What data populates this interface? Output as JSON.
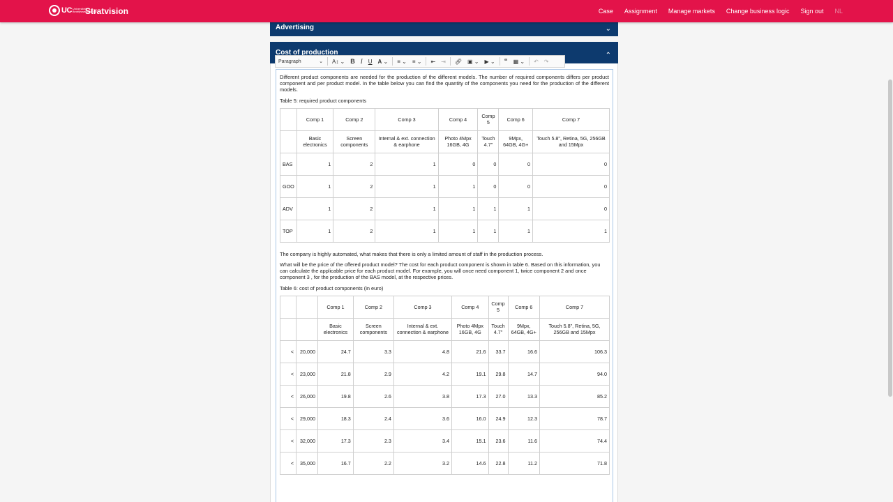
{
  "app": {
    "logo_text": "UC",
    "logo_sub": "Universiteit Bedrijfswetenschap",
    "title": "Stratvision"
  },
  "nav": {
    "items": [
      "Case",
      "Assignment",
      "Manage markets",
      "Change business logic",
      "Sign out"
    ],
    "lang": "NL"
  },
  "accordion": {
    "advertising": "Advertising",
    "cost": "Cost of production"
  },
  "toolbar": {
    "paragraph": "Paragraph"
  },
  "content": {
    "intro": "Different product components are needed for the production of the different models. The number of required components differs per product component and per product model. In the table below you can find the quantity of the components you need for the production of the different models.",
    "table5_caption": "Table 5: required product components",
    "automated": "The company is highly automated, what makes that there is only a limited amount of staff in the production process.",
    "price_text": "What will be the price of the offered product model? The cost for each product component is shown in table 6. Based on this information, you can calculate the applicable price for each product model. For example, you will once need component 1, twice component 2  and once component 3 , for the production of the BAS model, at the respective prices.",
    "table6_caption": "Table 6: cost of product components (in euro)"
  },
  "table5": {
    "headers": [
      "Comp 1",
      "Comp 2",
      "Comp 3",
      "Comp 4",
      "Comp 5",
      "Comp 6",
      "Comp 7"
    ],
    "descriptions": [
      "Basic electronics",
      "Screen components",
      "Internal & ext. connection & earphone",
      "Photo 4Mpx 16GB, 4G",
      "Touch 4.7\"",
      "9Mpx, 64GB, 4G+",
      "Touch 5.8\", Retina, 5G, 256GB and 15Mpx"
    ],
    "rows": [
      {
        "label": "BAS",
        "values": [
          "1",
          "2",
          "1",
          "0",
          "0",
          "0",
          "0"
        ]
      },
      {
        "label": "GOO",
        "values": [
          "1",
          "2",
          "1",
          "1",
          "0",
          "0",
          "0"
        ]
      },
      {
        "label": "ADV",
        "values": [
          "1",
          "2",
          "1",
          "1",
          "1",
          "1",
          "0"
        ]
      },
      {
        "label": "TOP",
        "values": [
          "1",
          "2",
          "1",
          "1",
          "1",
          "1",
          "1"
        ]
      }
    ]
  },
  "table6": {
    "headers": [
      "Comp 1",
      "Comp 2",
      "Comp 3",
      "Comp 4",
      "Comp 5",
      "Comp 6",
      "Comp 7"
    ],
    "descriptions": [
      "Basic electronics",
      "Screen components",
      "Internal & ext. connection & earphone",
      "Photo 4Mpx 16GB, 4G",
      "Touch 4.7\"",
      "9Mpx, 64GB, 4G+",
      "Touch 5.8\", Retina, 5G, 256GB and 15Mpx"
    ],
    "rows": [
      {
        "op": "<",
        "qty": "20,000",
        "values": [
          "24.7",
          "3.3",
          "4.8",
          "21.6",
          "33.7",
          "16.6",
          "106.3"
        ]
      },
      {
        "op": "<",
        "qty": "23,000",
        "values": [
          "21.8",
          "2.9",
          "4.2",
          "19.1",
          "29.8",
          "14.7",
          "94.0"
        ]
      },
      {
        "op": "<",
        "qty": "26,000",
        "values": [
          "19.8",
          "2.6",
          "3.8",
          "17.3",
          "27.0",
          "13.3",
          "85.2"
        ]
      },
      {
        "op": "<",
        "qty": "29,000",
        "values": [
          "18.3",
          "2.4",
          "3.6",
          "16.0",
          "24.9",
          "12.3",
          "78.7"
        ]
      },
      {
        "op": "<",
        "qty": "32,000",
        "values": [
          "17.3",
          "2.3",
          "3.4",
          "15.1",
          "23.6",
          "11.6",
          "74.4"
        ]
      },
      {
        "op": "<",
        "qty": "35,000",
        "values": [
          "16.7",
          "2.2",
          "3.2",
          "14.6",
          "22.8",
          "11.2",
          "71.8"
        ]
      }
    ]
  }
}
